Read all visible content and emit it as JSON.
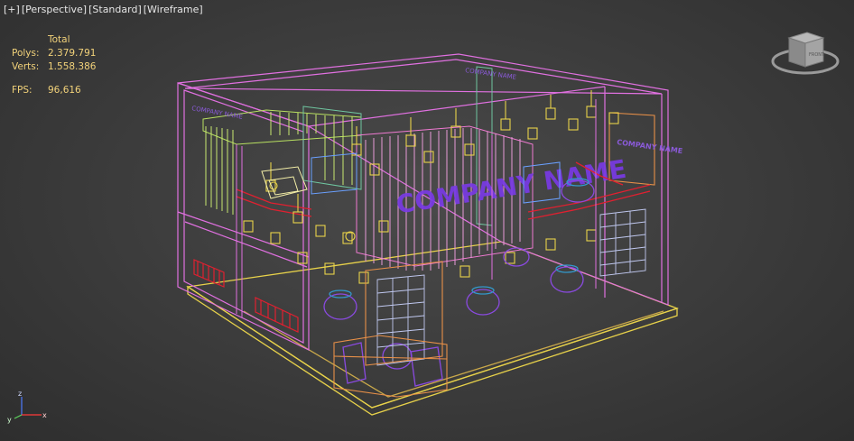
{
  "viewport": {
    "menu_plus": "[+]",
    "view": "[Perspective]",
    "preset": "[Standard]",
    "shading": "[Wireframe]"
  },
  "stats": {
    "header": "Total",
    "polys_label": "Polys:",
    "polys_value": "2.379.791",
    "verts_label": "Verts:",
    "verts_value": "1.558.386",
    "fps_label": "FPS:",
    "fps_value": "96,616"
  },
  "viewcube": {
    "face_label": "FRONT"
  },
  "axis": {
    "x": "x",
    "y": "y",
    "z": "z"
  },
  "scene": {
    "logo_text": "COMPANY NAME",
    "back_wall_text": "COMPANY NAME",
    "side_sign_text": "COMPANY NAME"
  },
  "colors": {
    "background": "#3b3b3b",
    "stats_text": "#f2d27a",
    "wire_magenta": "#e070e0",
    "wire_yellow": "#e8d24a",
    "wire_green": "#b8e060",
    "wire_blue": "#6aa0ff",
    "wire_red": "#e02030",
    "wire_purple": "#8a4ae0",
    "wire_orange": "#e89048"
  }
}
